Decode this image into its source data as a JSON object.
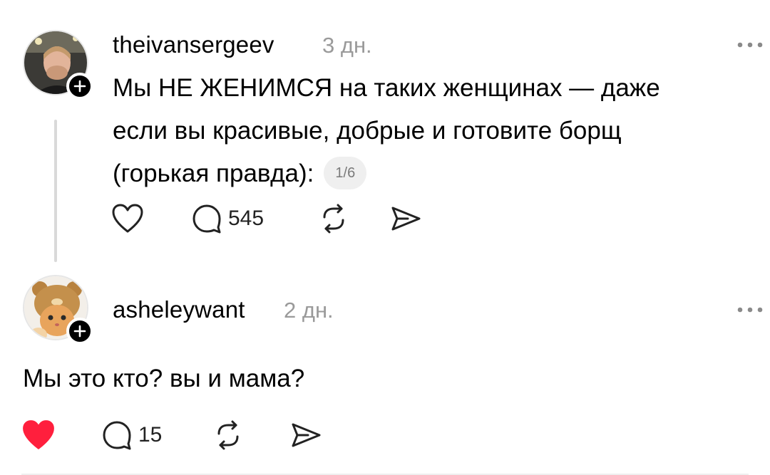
{
  "posts": [
    {
      "username": "theivansergeev",
      "time": "3 дн.",
      "text_lines": [
        "Мы НЕ ЖЕНИМСЯ на таких женщинах — даже",
        "если вы красивые, добрые и готовите борщ",
        "(горькая правда):"
      ],
      "page_indicator": "1/6",
      "liked": false,
      "reply_count": "545",
      "icons": [
        "heart-outline-icon",
        "comment-icon",
        "repost-icon",
        "share-icon",
        "more-icon"
      ]
    },
    {
      "username": "asheleywant",
      "time": "2 дн.",
      "text": "Мы это кто? вы и мама?",
      "liked": true,
      "reply_count": "15",
      "icons": [
        "heart-filled-icon",
        "comment-icon",
        "repost-icon",
        "share-icon",
        "more-icon"
      ]
    }
  ],
  "colors": {
    "like_red": "#ff1f3d",
    "muted_gray": "#9a9a9a",
    "thread_line": "#d9d9d9"
  }
}
